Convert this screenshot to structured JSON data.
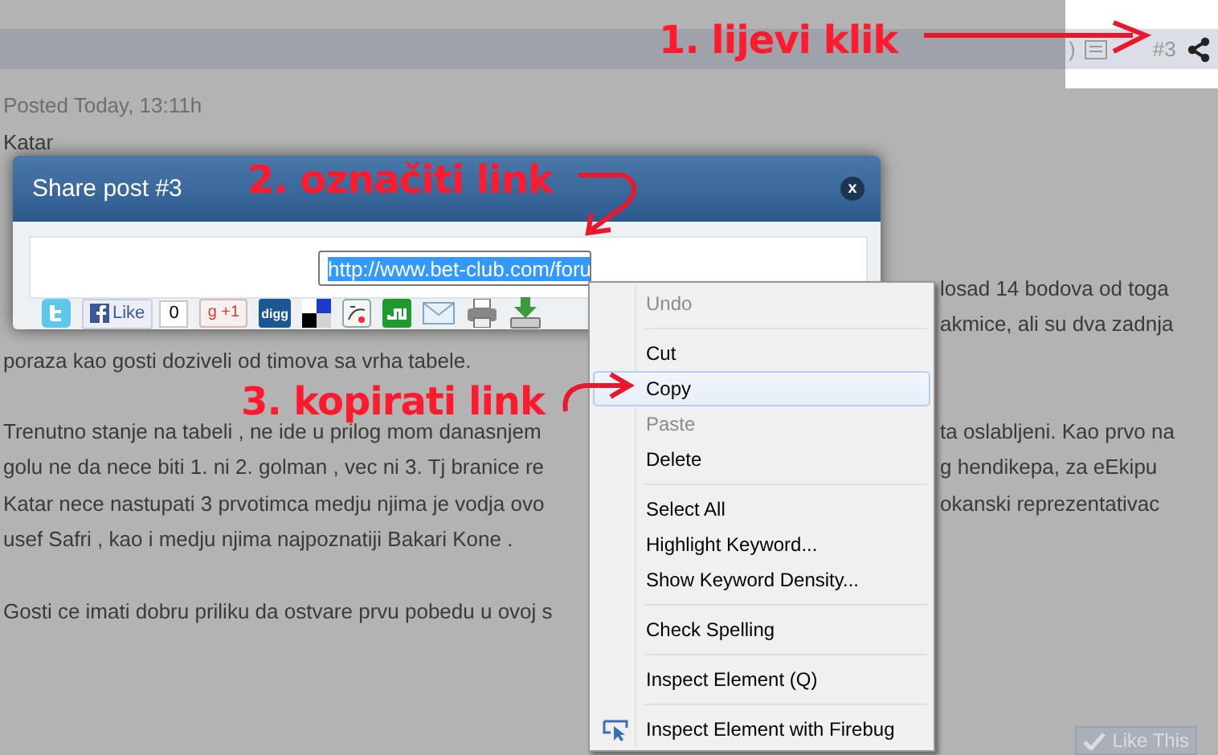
{
  "top_bar": {
    "post_number": "#3",
    "bracket": ")"
  },
  "post": {
    "meta": "Posted Today, 13:11h",
    "heading": "Katar",
    "paragraphs": [
      [
        {
          "right": "losad 14 bodova od toga"
        },
        {
          "right": "akmice, ali su dva zadnja"
        },
        {
          "left": "poraza kao gosti doziveli od timova sa vrha tabele."
        }
      ],
      [
        {
          "left": "Trenutno stanje na tabeli , ne ide u prilog mom danasnjem",
          "right": "ta oslabljeni. Kao prvo na"
        },
        {
          "left": "golu ne da nece biti 1. ni 2. golman , vec ni 3.  Tj branice re",
          "right": "g hendikepa, za eEkipu"
        },
        {
          "left": "Katar nece nastupati 3 prvotimca  medju njima je vodja ovo",
          "right": "okanski reprezentativac"
        },
        {
          "left": "usef Safri , kao i medju njima najpoznatiji Bakari Kone ."
        }
      ],
      [
        {
          "left": "Gosti ce imati dobru priliku da ostvare prvu pobedu u ovoj s"
        }
      ]
    ],
    "like_button": {
      "label": "Like This",
      "disabled": true
    }
  },
  "dialog": {
    "title": "Share post #3",
    "close": "x",
    "url": {
      "value": "http://www.bet-club.com/foru",
      "selected": true
    },
    "share_buttons": [
      {
        "kind": "twitter"
      },
      {
        "kind": "facebook",
        "label": "Like",
        "count": "0"
      },
      {
        "kind": "gplus",
        "logo": "g",
        "label": "+1"
      },
      {
        "kind": "digg",
        "label": "digg"
      },
      {
        "kind": "delicious"
      },
      {
        "kind": "bookmark"
      },
      {
        "kind": "stumble"
      },
      {
        "kind": "mail"
      },
      {
        "kind": "print"
      },
      {
        "kind": "download"
      }
    ]
  },
  "context_menu": [
    {
      "kind": "item",
      "label": "Undo",
      "disabled": true,
      "selected": false
    },
    {
      "kind": "separator"
    },
    {
      "kind": "item",
      "label": "Cut",
      "disabled": false,
      "selected": false
    },
    {
      "kind": "item",
      "label": "Copy",
      "disabled": false,
      "selected": true
    },
    {
      "kind": "item",
      "label": "Paste",
      "disabled": true,
      "selected": false
    },
    {
      "kind": "item",
      "label": "Delete",
      "disabled": false,
      "selected": false
    },
    {
      "kind": "separator"
    },
    {
      "kind": "item",
      "label": "Select All",
      "disabled": false,
      "selected": false
    },
    {
      "kind": "item",
      "label": "Highlight Keyword...",
      "disabled": false,
      "selected": false
    },
    {
      "kind": "item",
      "label": "Show Keyword Density...",
      "disabled": false,
      "selected": false
    },
    {
      "kind": "separator"
    },
    {
      "kind": "item",
      "label": "Check Spelling",
      "disabled": false,
      "selected": false
    },
    {
      "kind": "separator"
    },
    {
      "kind": "item",
      "label": "Inspect Element (Q)",
      "disabled": false,
      "selected": false
    },
    {
      "kind": "separator"
    },
    {
      "kind": "firebug",
      "label": "Inspect Element with Firebug",
      "disabled": false,
      "selected": false
    }
  ],
  "annotations": [
    "1. lijevi klik",
    "2. označiti link",
    "3. kopirati link"
  ]
}
